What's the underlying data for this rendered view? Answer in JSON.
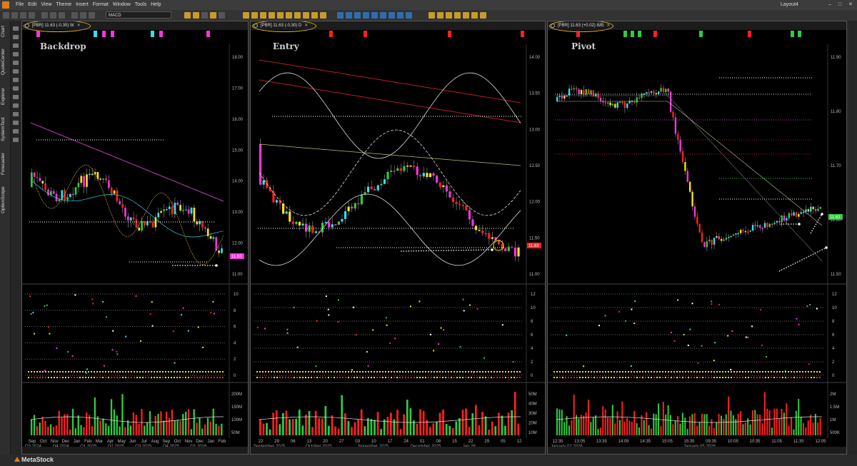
{
  "menu": {
    "items": [
      "File",
      "Edit",
      "View",
      "Theme",
      "Insert",
      "Format",
      "Window",
      "Tools",
      "Help"
    ],
    "layout": "Layout4"
  },
  "toolbar": {
    "indicator": "MACD"
  },
  "sidebar": {
    "tabs": [
      "Chart",
      "QuoteCenter",
      "Explorer",
      "SystemTest",
      "Forecaster",
      "OptionScope"
    ]
  },
  "colors": {
    "up": "#2ecc40",
    "down": "#ff2020",
    "yellow": "#ffe11a",
    "cyan": "#33e0f0",
    "magenta": "#ff33dd",
    "accent": "#e07b1e"
  },
  "panes": [
    {
      "tab": "[PBR] 11.63 (-0.30) W",
      "title": "Backdrop",
      "last_price": "11.63",
      "price_ticks": [
        "18.00",
        "17.00",
        "16.00",
        "15.00",
        "14.00",
        "13.00",
        "12.00",
        "11.00"
      ],
      "osc_ticks": [
        "10",
        "8",
        "6",
        "4",
        "2",
        "0"
      ],
      "vol_ticks": [
        "200M",
        "150M",
        "100M",
        "50M"
      ],
      "x_ticks": [
        "Sep",
        "Oct",
        "Nov",
        "Dec",
        "Jan",
        "Feb",
        "Mar",
        "Apr",
        "May",
        "Jun",
        "Jul",
        "Aug",
        "Sep",
        "Oct",
        "Nov",
        "Dec",
        "Jan",
        "Feb"
      ],
      "periods": [
        "Q3 2024",
        "Q4 2024",
        "Q1 2025",
        "Q2 2025",
        "Q3 2025",
        "Q4 2025",
        "Q1 2026"
      ],
      "top_markers": [
        "magenta",
        "cyan",
        "magenta",
        "magenta",
        "cyan",
        "magenta",
        "magenta"
      ]
    },
    {
      "tab": "[PBR] 11.63 (-0.30) D",
      "title": "Entry",
      "last_price": "11.63",
      "price_ticks": [
        "14.00",
        "13.50",
        "13.00",
        "12.50",
        "12.00",
        "11.50",
        "11.00"
      ],
      "osc_ticks": [
        "12",
        "10",
        "8",
        "6",
        "4",
        "2",
        "0"
      ],
      "vol_ticks": [
        "50M",
        "40M",
        "30M",
        "20M",
        "10M"
      ],
      "x_ticks": [
        "22",
        "29",
        "06",
        "13",
        "20",
        "27",
        "03",
        "10",
        "17",
        "24",
        "01",
        "08",
        "15",
        "22",
        "29",
        "05",
        "12"
      ],
      "periods": [
        "September 2025",
        "October 2025",
        "November 2025",
        "December 2025",
        "Jan 26"
      ],
      "top_markers": [
        "red",
        "red",
        "red",
        "red"
      ]
    },
    {
      "tab": "[PBR] 11.63 (+0.02) IM5",
      "title": "Pivot",
      "last_price": "11.63",
      "price_ticks": [
        "11.90",
        "11.80",
        "11.70",
        "11.60",
        "11.50"
      ],
      "osc_ticks": [
        "12",
        "10",
        "8",
        "6",
        "4",
        "2",
        "0"
      ],
      "vol_ticks": [
        "2M",
        "1.5M",
        "1M",
        "500K"
      ],
      "x_ticks": [
        "12:35",
        "13:05",
        "13:35",
        "14:05",
        "14:35",
        "15:05",
        "15:35",
        "09:35",
        "10:05",
        "10:35",
        "11:05",
        "11:35",
        "12:05"
      ],
      "periods": [
        "January 02 2026",
        "January 05 2026"
      ],
      "top_markers": [
        "red",
        "green",
        "green",
        "green",
        "red",
        "green",
        "red",
        "green",
        "green"
      ]
    }
  ],
  "status": {
    "logo": "MetaStock"
  }
}
